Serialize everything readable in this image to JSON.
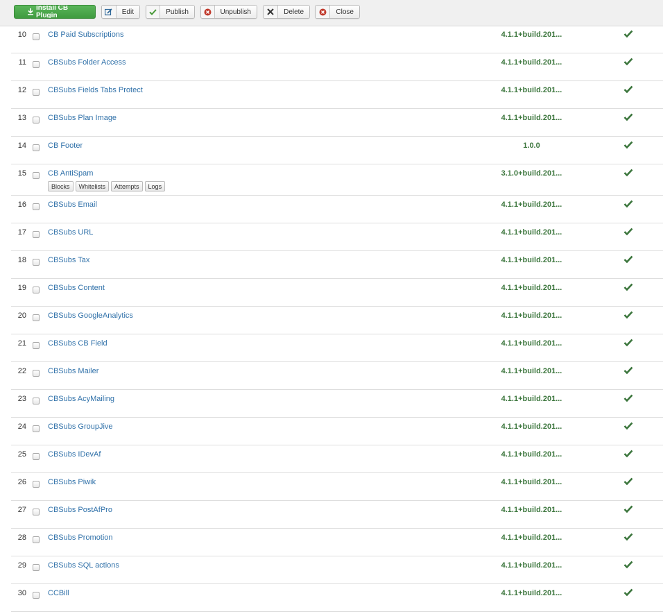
{
  "toolbar": {
    "install_label": "Install CB Plugin",
    "edit_label": "Edit",
    "publish_label": "Publish",
    "unpublish_label": "Unpublish",
    "delete_label": "Delete",
    "close_label": "Close"
  },
  "colors": {
    "accent_green": "#4aa84a",
    "link_blue": "#3071a9",
    "version_green": "#3c763d",
    "unpublish_red": "#c0392b"
  },
  "rows": [
    {
      "num": "10",
      "name": "CB Paid Subscriptions",
      "version": "4.1.1+build.201..."
    },
    {
      "num": "11",
      "name": "CBSubs Folder Access",
      "version": "4.1.1+build.201..."
    },
    {
      "num": "12",
      "name": "CBSubs Fields Tabs Protect",
      "version": "4.1.1+build.201..."
    },
    {
      "num": "13",
      "name": "CBSubs Plan Image",
      "version": "4.1.1+build.201..."
    },
    {
      "num": "14",
      "name": "CB Footer",
      "version": "1.0.0"
    },
    {
      "num": "15",
      "name": "CB AntiSpam",
      "version": "3.1.0+build.201...",
      "sub_buttons": [
        "Blocks",
        "Whitelists",
        "Attempts",
        "Logs"
      ]
    },
    {
      "num": "16",
      "name": "CBSubs Email",
      "version": "4.1.1+build.201..."
    },
    {
      "num": "17",
      "name": "CBSubs URL",
      "version": "4.1.1+build.201..."
    },
    {
      "num": "18",
      "name": "CBSubs Tax",
      "version": "4.1.1+build.201..."
    },
    {
      "num": "19",
      "name": "CBSubs Content",
      "version": "4.1.1+build.201..."
    },
    {
      "num": "20",
      "name": "CBSubs GoogleAnalytics",
      "version": "4.1.1+build.201..."
    },
    {
      "num": "21",
      "name": "CBSubs CB Field",
      "version": "4.1.1+build.201..."
    },
    {
      "num": "22",
      "name": "CBSubs Mailer",
      "version": "4.1.1+build.201..."
    },
    {
      "num": "23",
      "name": "CBSubs AcyMailing",
      "version": "4.1.1+build.201..."
    },
    {
      "num": "24",
      "name": "CBSubs GroupJive",
      "version": "4.1.1+build.201..."
    },
    {
      "num": "25",
      "name": "CBSubs IDevAf",
      "version": "4.1.1+build.201..."
    },
    {
      "num": "26",
      "name": "CBSubs Piwik",
      "version": "4.1.1+build.201..."
    },
    {
      "num": "27",
      "name": "CBSubs PostAfPro",
      "version": "4.1.1+build.201..."
    },
    {
      "num": "28",
      "name": "CBSubs Promotion",
      "version": "4.1.1+build.201..."
    },
    {
      "num": "29",
      "name": "CBSubs SQL actions",
      "version": "4.1.1+build.201..."
    },
    {
      "num": "30",
      "name": "CCBill",
      "version": "4.1.1+build.201..."
    }
  ]
}
